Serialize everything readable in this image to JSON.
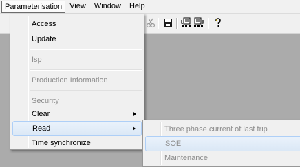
{
  "menubar": {
    "items": [
      "Parameterisation",
      "View",
      "Window",
      "Help"
    ]
  },
  "toolbar": {
    "icons": [
      "cut-icon",
      "save-icon",
      "download-icon",
      "upload-icon",
      "help-icon"
    ]
  },
  "parameterisation_menu": {
    "items": [
      {
        "label": "Access",
        "enabled": true
      },
      {
        "label": "Update",
        "enabled": true
      },
      {
        "label": "Isp",
        "enabled": false
      },
      {
        "label": "Production Information",
        "enabled": false
      },
      {
        "label": "Security",
        "enabled": false
      },
      {
        "label": "Clear",
        "enabled": true,
        "submenu": true
      },
      {
        "label": "Read",
        "enabled": true,
        "submenu": true,
        "highlighted": true
      },
      {
        "label": "Time synchronize",
        "enabled": true
      }
    ]
  },
  "read_submenu": {
    "items": [
      {
        "label": "Three phase current of last trip",
        "enabled": false
      },
      {
        "label": "SOE",
        "enabled": false,
        "highlighted": true
      },
      {
        "label": "Maintenance",
        "enabled": false
      }
    ]
  }
}
